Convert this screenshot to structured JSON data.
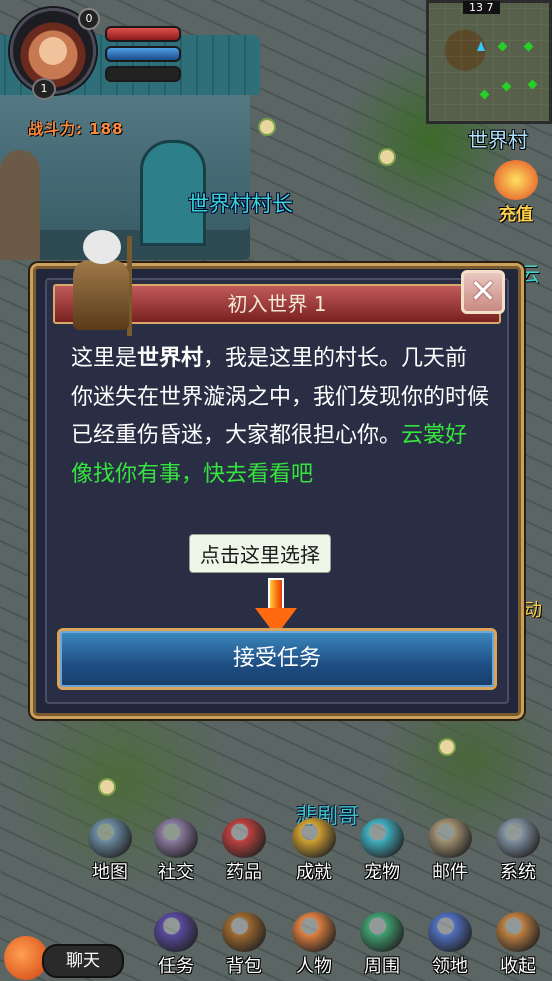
{
  "hud": {
    "power_label": "战斗力: 188",
    "level": "1",
    "notif_count": "0"
  },
  "minimap": {
    "coord": "13 7",
    "location": "世界村"
  },
  "recharge_label": "充值",
  "npc": {
    "name": "世界村村长",
    "nearby_name": "悲剧哥",
    "edge_label_right": "云",
    "edge_label_right2": "动"
  },
  "dialog": {
    "title": "初入世界 1",
    "close_label": "✕",
    "text_prefix": "这里是",
    "text_place": "世界村",
    "text_main": "，我是这里的村长。几天前你迷失在世界漩涡之中，我们发现你的时候已经重伤昏迷，大家都很担心你。",
    "text_quest": "云裳好像找你有事，快去看看吧",
    "tooltip": "点击这里选择",
    "accept_label": "接受任务"
  },
  "menu_row1": [
    {
      "label": "地图",
      "icon": "map-icon",
      "color": "#6a8aa0"
    },
    {
      "label": "社交",
      "icon": "social-icon",
      "color": "#8a7aa0"
    },
    {
      "label": "药品",
      "icon": "potion-icon",
      "color": "#c04040"
    },
    {
      "label": "成就",
      "icon": "trophy-icon",
      "color": "#d0a030"
    },
    {
      "label": "宠物",
      "icon": "pet-icon",
      "color": "#40b0c0"
    },
    {
      "label": "邮件",
      "icon": "mail-icon",
      "color": "#a09070"
    },
    {
      "label": "系统",
      "icon": "gear-icon",
      "color": "#8090a0"
    }
  ],
  "menu_row2": [
    {
      "label": "任务",
      "icon": "quest-book-icon",
      "color": "#5a4aa0"
    },
    {
      "label": "背包",
      "icon": "bag-icon",
      "color": "#a06a30"
    },
    {
      "label": "人物",
      "icon": "character-icon",
      "color": "#e08040"
    },
    {
      "label": "周围",
      "icon": "nearby-icon",
      "color": "#40a070"
    },
    {
      "label": "领地",
      "icon": "territory-icon",
      "color": "#5070c0"
    },
    {
      "label": "收起",
      "icon": "collapse-icon",
      "color": "#c08040"
    }
  ],
  "chat_label": "聊天",
  "colors": {
    "accent_gold": "#caa05a",
    "quest_green": "#35e43e",
    "npc_cyan": "#38d8d0"
  }
}
